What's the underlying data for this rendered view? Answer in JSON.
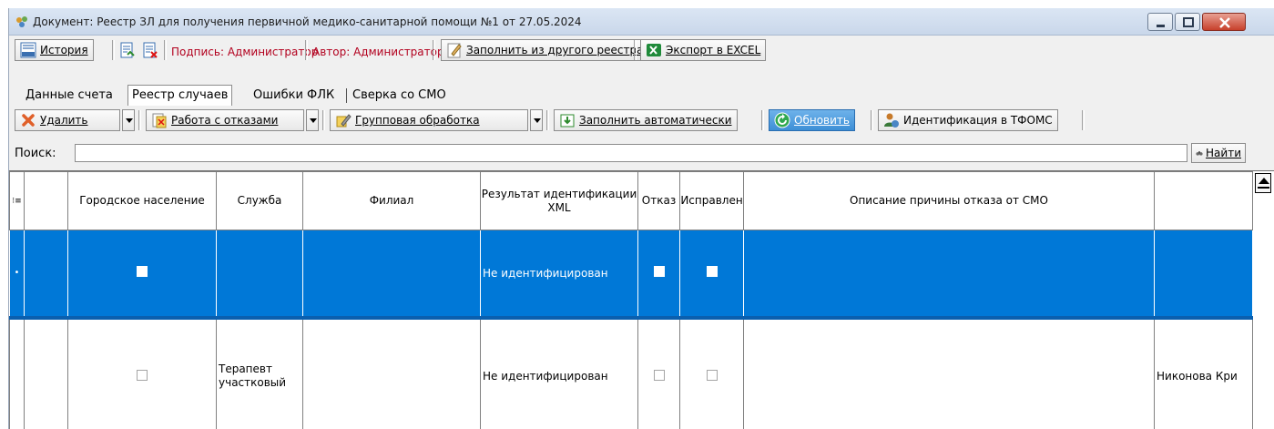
{
  "window": {
    "title": "Документ: Реестр ЗЛ для получения первичной медико-санитарной помощи №1 от 27.05.2024"
  },
  "toolbar_main": {
    "history_label": "История",
    "sign_label": "Подпись: Администратор",
    "author_label": "Автор: Администратор",
    "fill_from_other_label": "Заполнить из другого реестра",
    "export_excel_label": "Экспорт в EXCEL"
  },
  "tabs": [
    {
      "label": "Данные счета",
      "active": false
    },
    {
      "label": "Реестр случаев",
      "active": true
    },
    {
      "label": "Ошибки ФЛК",
      "active": false
    },
    {
      "label": "Сверка со СМО",
      "active": false
    }
  ],
  "toolbar_actions": {
    "delete_label": "Удалить",
    "rejections_label": "Работа с отказами",
    "group_processing_label": "Групповая обработка",
    "autofill_label": "Заполнить автоматически",
    "refresh_label": "Обновить",
    "tfoms_ident_label": "Идентификация в ТФОМС"
  },
  "search": {
    "label": "Поиск:",
    "value": "",
    "find_label": "Найти"
  },
  "grid": {
    "columns": [
      "",
      "Городское население",
      "Служба",
      "Филиал",
      "Результат идентификации XML",
      "Отказ",
      "Исправлен",
      "Описание причины отказа от СМО",
      ""
    ],
    "rows": [
      {
        "selected": true,
        "marker": "•",
        "urban": false,
        "service": "",
        "branch": "",
        "xml_result": "Не идентифицирован",
        "rejected": false,
        "fixed": false,
        "reason": "",
        "doctor": ""
      },
      {
        "selected": false,
        "marker": "",
        "urban": false,
        "service": "Терапевт участковый",
        "branch": "",
        "xml_result": "Не идентифицирован",
        "rejected": false,
        "fixed": false,
        "reason": "",
        "doctor": "Никонова Кри"
      }
    ]
  },
  "colors": {
    "selection": "#0078d7",
    "accent_red": "#b2001e",
    "refresh_button": "#3d8fd6"
  }
}
